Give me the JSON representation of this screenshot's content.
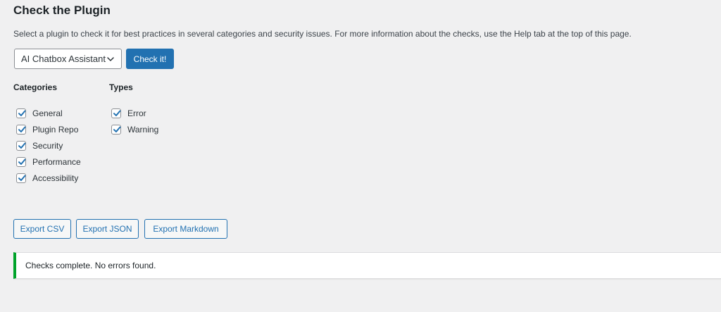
{
  "page": {
    "title": "Check the Plugin",
    "intro": "Select a plugin to check it for best practices in several categories and security issues. For more information about the checks, use the Help tab at the top of this page."
  },
  "plugin_select": {
    "selected": "AI Chatbox Assistant"
  },
  "check_button": {
    "label": "Check it!"
  },
  "categories": {
    "heading": "Categories",
    "items": [
      {
        "label": "General",
        "checked": true
      },
      {
        "label": "Plugin Repo",
        "checked": true
      },
      {
        "label": "Security",
        "checked": true
      },
      {
        "label": "Performance",
        "checked": true
      },
      {
        "label": "Accessibility",
        "checked": true
      }
    ]
  },
  "types": {
    "heading": "Types",
    "items": [
      {
        "label": "Error",
        "checked": true
      },
      {
        "label": "Warning",
        "checked": true
      }
    ]
  },
  "export": {
    "csv_label": "Export CSV",
    "json_label": "Export JSON",
    "markdown_label": "Export Markdown"
  },
  "notice": {
    "text": "Checks complete. No errors found.",
    "status_color": "#00a32a"
  },
  "colors": {
    "accent": "#2271b1",
    "background": "#f0f0f1"
  }
}
